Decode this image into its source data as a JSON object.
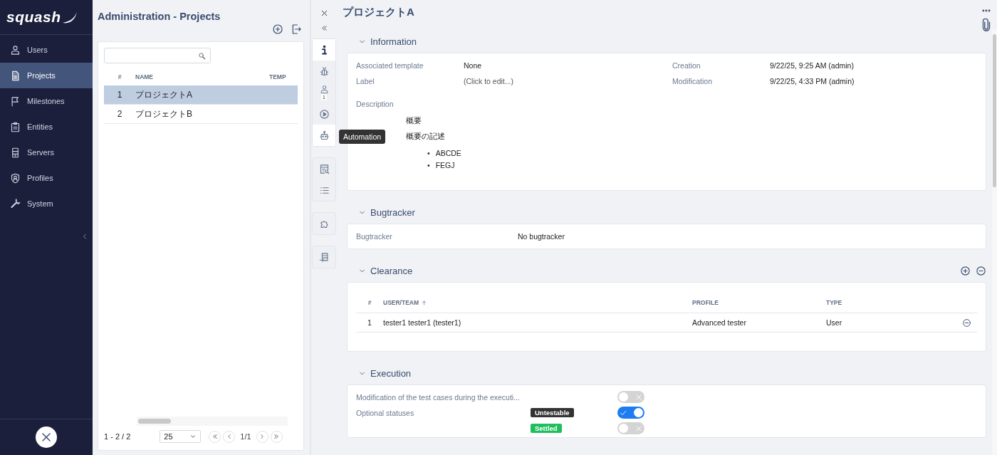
{
  "sidebar": {
    "logo": "squash",
    "items": [
      {
        "label": "Users",
        "selected": false
      },
      {
        "label": "Projects",
        "selected": true
      },
      {
        "label": "Milestones",
        "selected": false
      },
      {
        "label": "Entities",
        "selected": false
      },
      {
        "label": "Servers",
        "selected": false
      },
      {
        "label": "Profiles",
        "selected": false
      },
      {
        "label": "System",
        "selected": false
      }
    ]
  },
  "projects": {
    "title": "Administration - Projects",
    "table": {
      "columns": [
        "#",
        "NAME",
        "TEMP"
      ],
      "rows": [
        {
          "index": "1",
          "name": "プロジェクトA",
          "selected": true
        },
        {
          "index": "2",
          "name": "プロジェクトB",
          "selected": false
        }
      ]
    },
    "footer": {
      "range": "1 - 2 / 2",
      "page_size": "25",
      "page": "1/1"
    }
  },
  "side_tabs": {
    "groups": [
      {
        "tabs": [
          {
            "selected": true,
            "hovered": false
          },
          {
            "selected": false,
            "hovered": false
          },
          {
            "selected": false,
            "hovered": false,
            "badge": "1"
          },
          {
            "selected": false,
            "hovered": false
          },
          {
            "selected": false,
            "hovered": true,
            "tooltip": "Automation"
          }
        ]
      },
      {
        "tabs": [
          {
            "selected": false,
            "hovered": false
          },
          {
            "selected": false,
            "hovered": false
          }
        ]
      },
      {
        "tabs": [
          {
            "selected": false,
            "hovered": false
          }
        ]
      },
      {
        "tabs": [
          {
            "selected": false,
            "hovered": false
          }
        ]
      }
    ]
  },
  "detail": {
    "title": "プロジェクトA",
    "information": {
      "heading": "Information",
      "expanded": true,
      "fields": [
        {
          "label": "Associated template",
          "value": "None",
          "kind": "text"
        },
        {
          "label": "Creation",
          "value": "9/22/25, 9:25 AM (admin)",
          "kind": "text"
        },
        {
          "label": "Label",
          "value": "(Click to edit...)",
          "kind": "placeholder"
        },
        {
          "label": "Modification",
          "value": "9/22/25, 4:33 PM (admin)",
          "kind": "text"
        }
      ],
      "description": {
        "label": "Description",
        "heading": "概要",
        "paragraph": "概要の記述",
        "bullets": [
          {
            "marker": "•",
            "text": "ABCDE"
          },
          {
            "marker": "•",
            "text": "FEGJ"
          }
        ]
      }
    },
    "bugtracker": {
      "heading": "Bugtracker",
      "expanded": true,
      "label": "Bugtracker",
      "value": "No bugtracker"
    },
    "clearance": {
      "heading": "Clearance",
      "expanded": true,
      "columns": [
        {
          "label": "#",
          "sorted": false
        },
        {
          "label": "USER/TEAM",
          "sorted": true
        },
        {
          "label": "PROFILE",
          "sorted": false
        },
        {
          "label": "TYPE",
          "sorted": false
        }
      ],
      "rows": [
        {
          "index": "1",
          "user": "tester1 tester1 (tester1)",
          "profile": "Advanced tester",
          "type": "User"
        }
      ]
    },
    "execution": {
      "heading": "Execution",
      "expanded": true,
      "rows": [
        {
          "label": "Modification of the test cases during the executi...",
          "on": false
        },
        {
          "label": "Optional statuses",
          "badge": {
            "text": "Untestable",
            "color": "#333333"
          },
          "on": true
        },
        {
          "badge": {
            "text": "Settled",
            "color": "#1fbf5f"
          },
          "on": false
        }
      ]
    }
  }
}
